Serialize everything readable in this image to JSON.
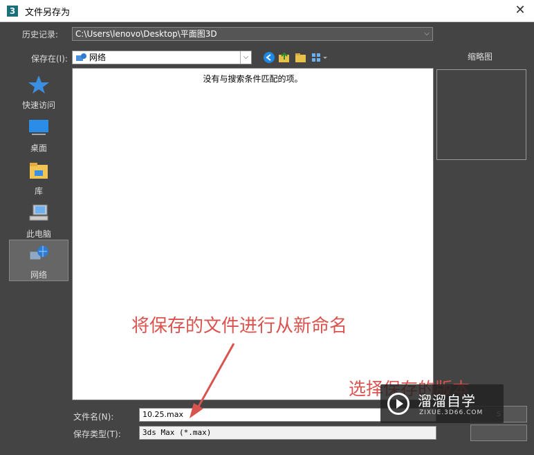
{
  "window": {
    "title": "文件另存为",
    "close_glyph": "✕"
  },
  "history": {
    "label": "历史记录:",
    "value": "C:\\Users\\lenovo\\Desktop\\平面图3D"
  },
  "save_in": {
    "label": "保存在(I):",
    "value": "网络"
  },
  "sidebar": {
    "items": [
      {
        "label": "快速访问",
        "icon": "star-icon"
      },
      {
        "label": "桌面",
        "icon": "desktop-icon"
      },
      {
        "label": "库",
        "icon": "library-folder-icon"
      },
      {
        "label": "此电脑",
        "icon": "computer-icon"
      },
      {
        "label": "网络",
        "icon": "network-icon"
      }
    ]
  },
  "filelist": {
    "empty_message": "没有与搜索条件匹配的项。"
  },
  "thumbnail": {
    "label": "缩略图"
  },
  "filename": {
    "label": "文件名(N):",
    "value": "10.25.max"
  },
  "filetype": {
    "label": "保存类型(T):",
    "value": "3ds Max (*.max)"
  },
  "annotations": {
    "rename_hint": "将保存的文件进行从新命名",
    "version_hint_partial": "选择保存的版本"
  },
  "watermark": {
    "title": "溜溜自学",
    "url": "ZIXUE.3D66.COM"
  },
  "colors": {
    "dialog_bg": "#444444",
    "annotation_red": "#d9534f",
    "accent_blue": "#1e88e5"
  }
}
